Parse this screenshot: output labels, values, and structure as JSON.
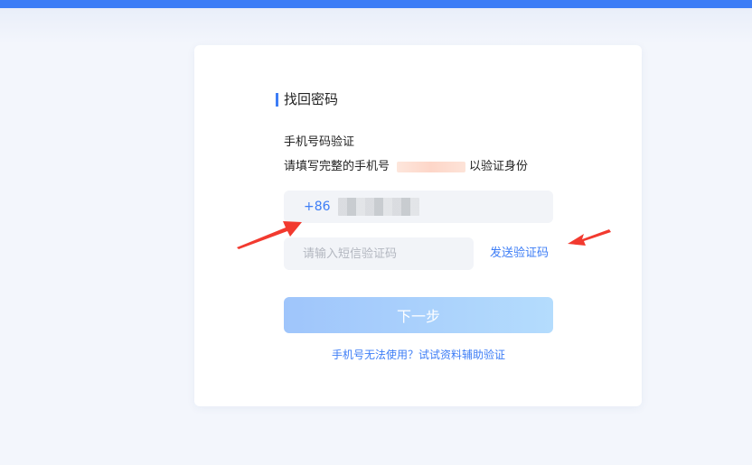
{
  "header": {
    "accent_color": "#3d7df6"
  },
  "card": {
    "section_title": "找回密码",
    "subheading": "手机号码验证",
    "instruction_prefix": "请填写完整的手机号",
    "instruction_suffix": "以验证身份"
  },
  "form": {
    "country_code": "+86",
    "code_placeholder": "请输入短信验证码",
    "send_code_label": "发送验证码",
    "next_label": "下一步",
    "alt_verify_link": "手机号无法使用？试试资料辅助验证"
  },
  "annotations": {
    "arrow_color": "#f23a2f",
    "icons": [
      "annotation-arrow-icon"
    ]
  }
}
